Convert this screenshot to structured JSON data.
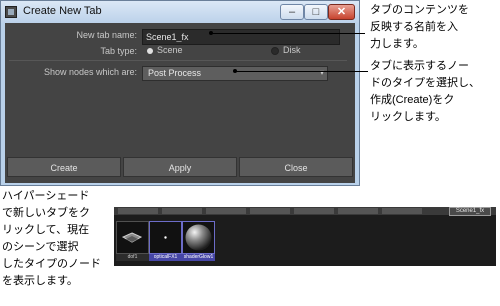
{
  "dialog": {
    "title": "Create New Tab",
    "tab_name_label": "New tab name:",
    "tab_name_value": "Scene1_fx",
    "tab_type_label": "Tab type:",
    "tab_type_options": [
      "Scene",
      "Disk"
    ],
    "tab_type_selected": "Scene",
    "show_nodes_label": "Show nodes which are:",
    "show_nodes_value": "Post Process",
    "buttons": {
      "create": "Create",
      "apply": "Apply",
      "close": "Close"
    },
    "window_buttons": {
      "minimize": "–",
      "maximize": "□",
      "close": "✕"
    }
  },
  "hypershade": {
    "active_tab": "Scene1_fx",
    "swatches": [
      {
        "label": "dof1",
        "icon": "dof-node-icon",
        "selected": false
      },
      {
        "label": "opticalFX1",
        "icon": "optical-fx-icon",
        "selected": true
      },
      {
        "label": "shaderGlow1",
        "icon": "shader-glow-sphere-icon",
        "selected": true
      }
    ]
  },
  "annotations": {
    "tab_name_note": "タブのコンテンツを\n反映する名前を入\n力します。",
    "node_type_note": "タブに表示するノー\nドのタイプを選択し、\n作成(Create)をク\nリックします。",
    "hypershade_note": "ハイパーシェード\nで新しいタブをク\nリックして、現在\nのシーンで選択\nしたタイプのノード\nを表示します。"
  }
}
